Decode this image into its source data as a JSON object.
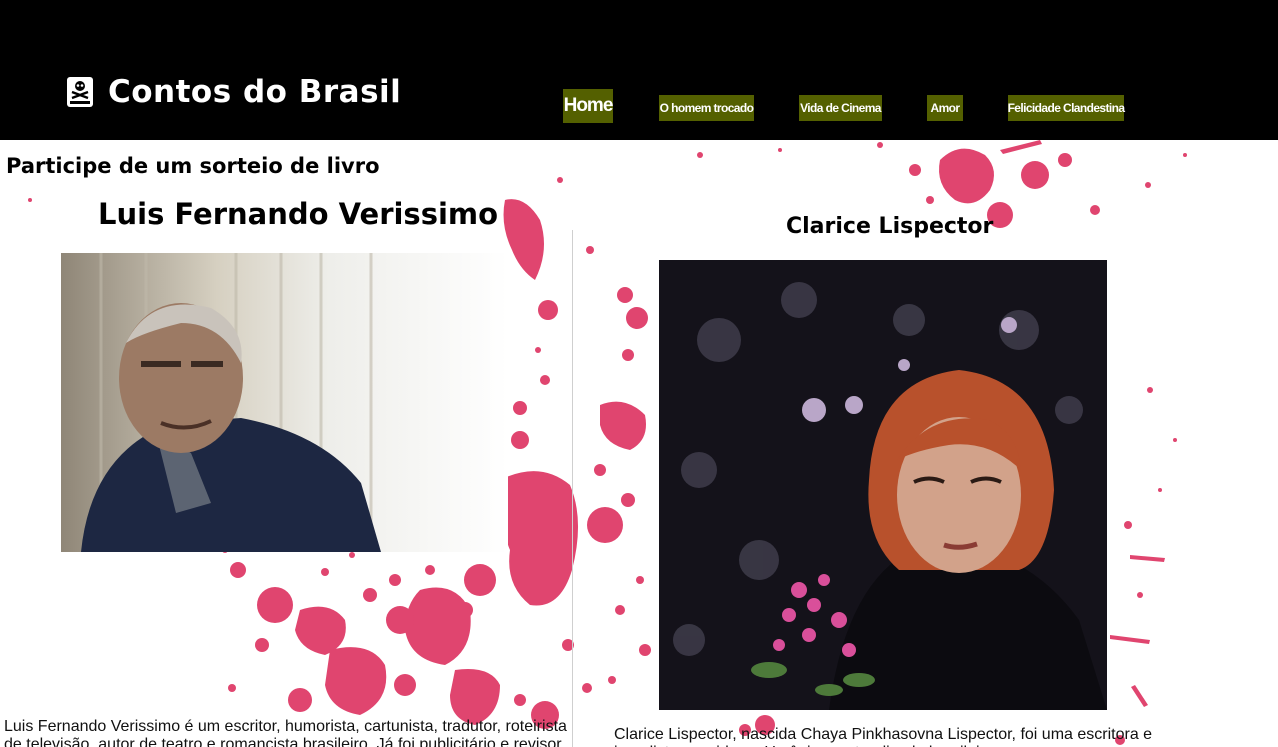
{
  "header": {
    "title": "Contos do Brasil",
    "icon": "book-skull-icon",
    "background": "#000000"
  },
  "nav": {
    "accent": "#546000",
    "items": [
      {
        "label": "Home",
        "active": true
      },
      {
        "label": "O homem trocado",
        "active": false
      },
      {
        "label": "Vida de Cinema",
        "active": false
      },
      {
        "label": "Amor",
        "active": false
      },
      {
        "label": "Felicidade Clandestina",
        "active": false
      }
    ]
  },
  "main": {
    "promo": "Participe de um sorteio de livro",
    "splatter_color": "#e0456f",
    "authors": [
      {
        "name": "Luis Fernando Verissimo",
        "photo": "portrait-verissimo",
        "bio": "Luis Fernando Verissimo é um escritor, humorista, cartunista, tradutor, roteirista de televisão, autor de teatro e romancista brasileiro. Já foi publicitário e revisor"
      },
      {
        "name": "Clarice Lispector",
        "photo": "portrait-lispector",
        "bio": "Clarice Lispector, nascida Chaya Pinkhasovna Lispector, foi uma escritora e jornalista nascida na Ucrânia e naturalizada brasileira"
      }
    ]
  }
}
